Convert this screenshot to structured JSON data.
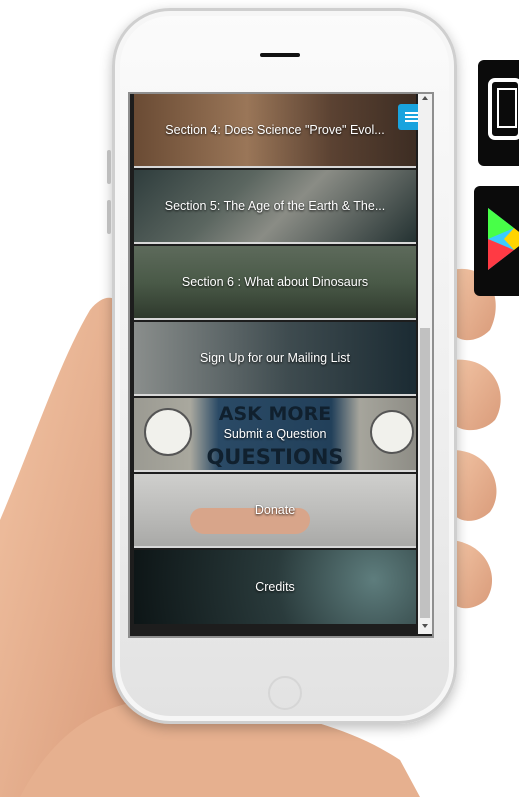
{
  "menu": {
    "items": [
      {
        "label": "Section 4: Does Science \"Prove\" Evol..."
      },
      {
        "label": "Section 5: The Age of the Earth & The..."
      },
      {
        "label": "Section 6 : What about Dinosaurs"
      },
      {
        "label": "Sign Up for our Mailing List"
      },
      {
        "label": "Submit a Question"
      },
      {
        "label": "Donate"
      },
      {
        "label": "Credits"
      }
    ]
  },
  "images": {
    "ask_more_questions_sign": "ASK MORE QUESTIONS"
  },
  "icons": [
    "hamburger-menu-icon",
    "apple-store-icon",
    "google-play-icon"
  ],
  "colors": {
    "menu_button": "#19a3de",
    "item_divider": "#d8d8d8"
  }
}
